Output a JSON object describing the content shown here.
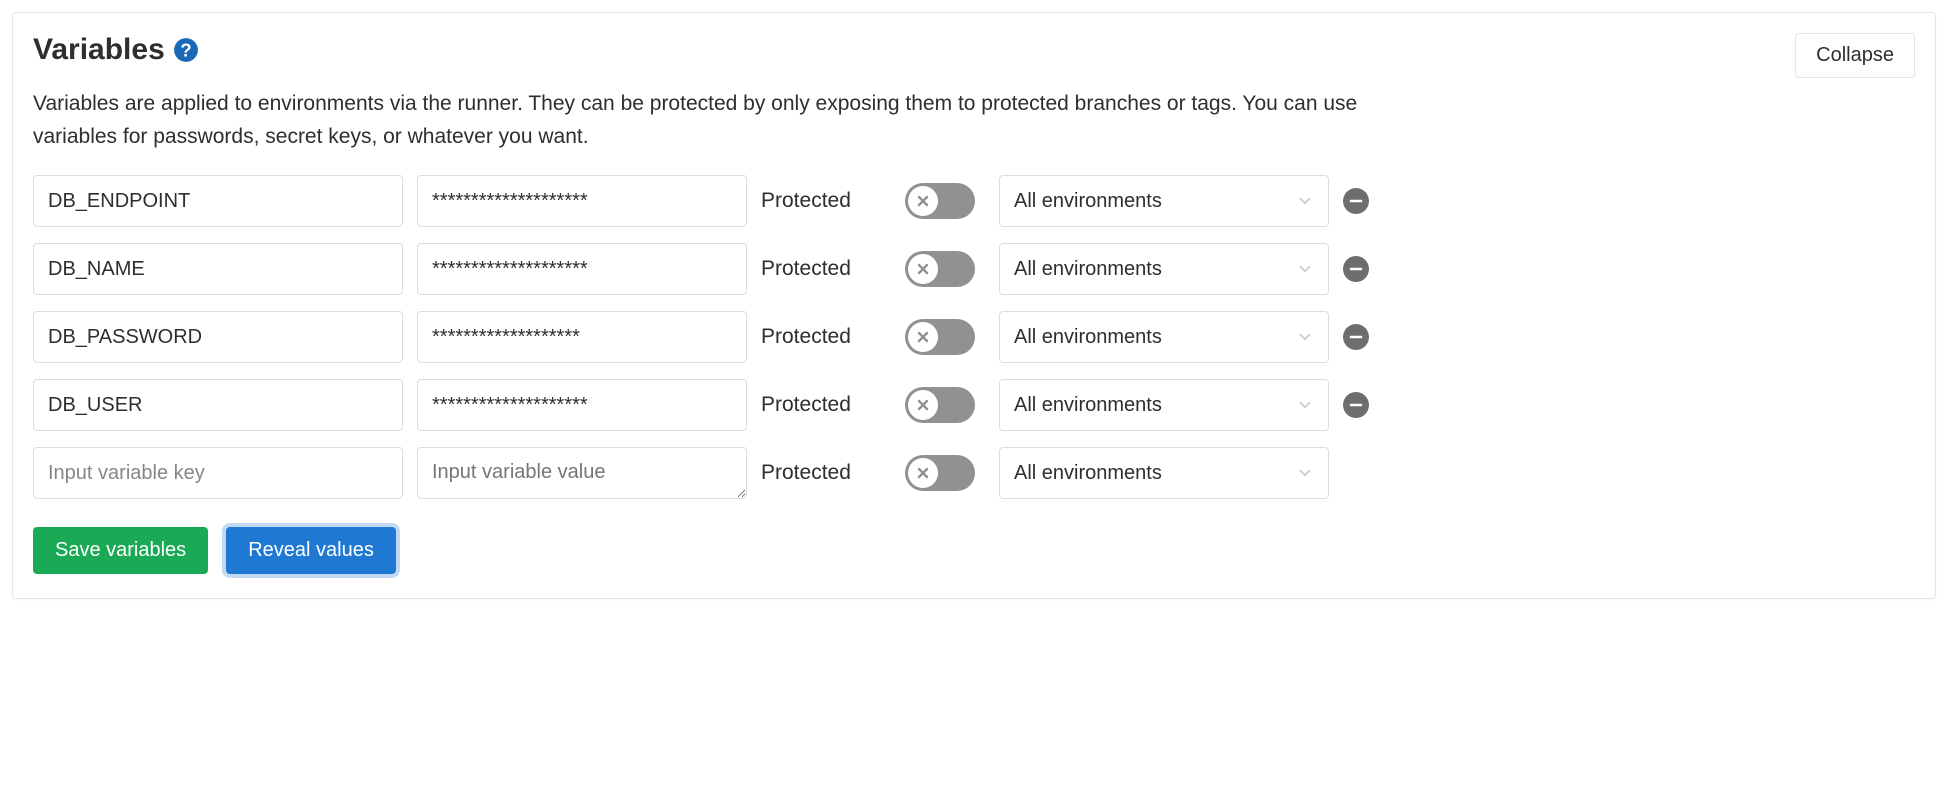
{
  "header": {
    "title": "Variables",
    "collapse_label": "Collapse",
    "description": "Variables are applied to environments via the runner. They can be protected by only exposing them to protected branches or tags. You can use variables for passwords, secret keys, or whatever you want."
  },
  "labels": {
    "protected": "Protected",
    "key_placeholder": "Input variable key",
    "value_placeholder": "Input variable value",
    "env_default": "All environments"
  },
  "variables": [
    {
      "key": "DB_ENDPOINT",
      "value": "********************",
      "protected": false,
      "environment": "All environments"
    },
    {
      "key": "DB_NAME",
      "value": "********************",
      "protected": false,
      "environment": "All environments"
    },
    {
      "key": "DB_PASSWORD",
      "value": "*******************",
      "protected": false,
      "environment": "All environments"
    },
    {
      "key": "DB_USER",
      "value": "********************",
      "protected": false,
      "environment": "All environments"
    }
  ],
  "actions": {
    "save_label": "Save variables",
    "reveal_label": "Reveal values"
  }
}
